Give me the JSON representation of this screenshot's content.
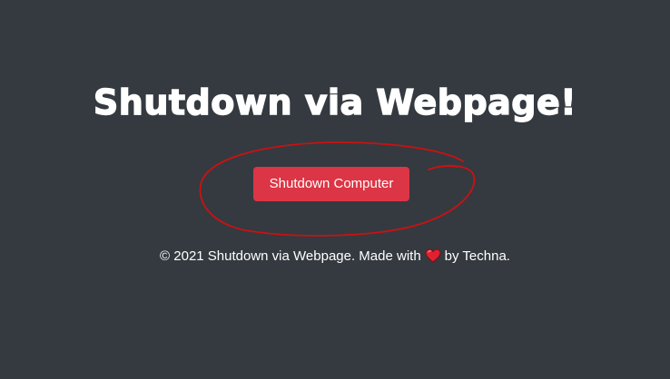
{
  "header": {
    "title": "Shutdown via Webpage!"
  },
  "main": {
    "shutdown_button_label": "Shutdown Computer"
  },
  "footer": {
    "before_icon": "© 2021 Shutdown via Webpage. Made with",
    "icon": "heart-icon",
    "after_icon": "by Techna."
  },
  "colors": {
    "background": "#343a40",
    "button": "#dc3545",
    "text": "#ffffff",
    "annotation_circle": "#cc1111",
    "heart": "#e0212f"
  }
}
